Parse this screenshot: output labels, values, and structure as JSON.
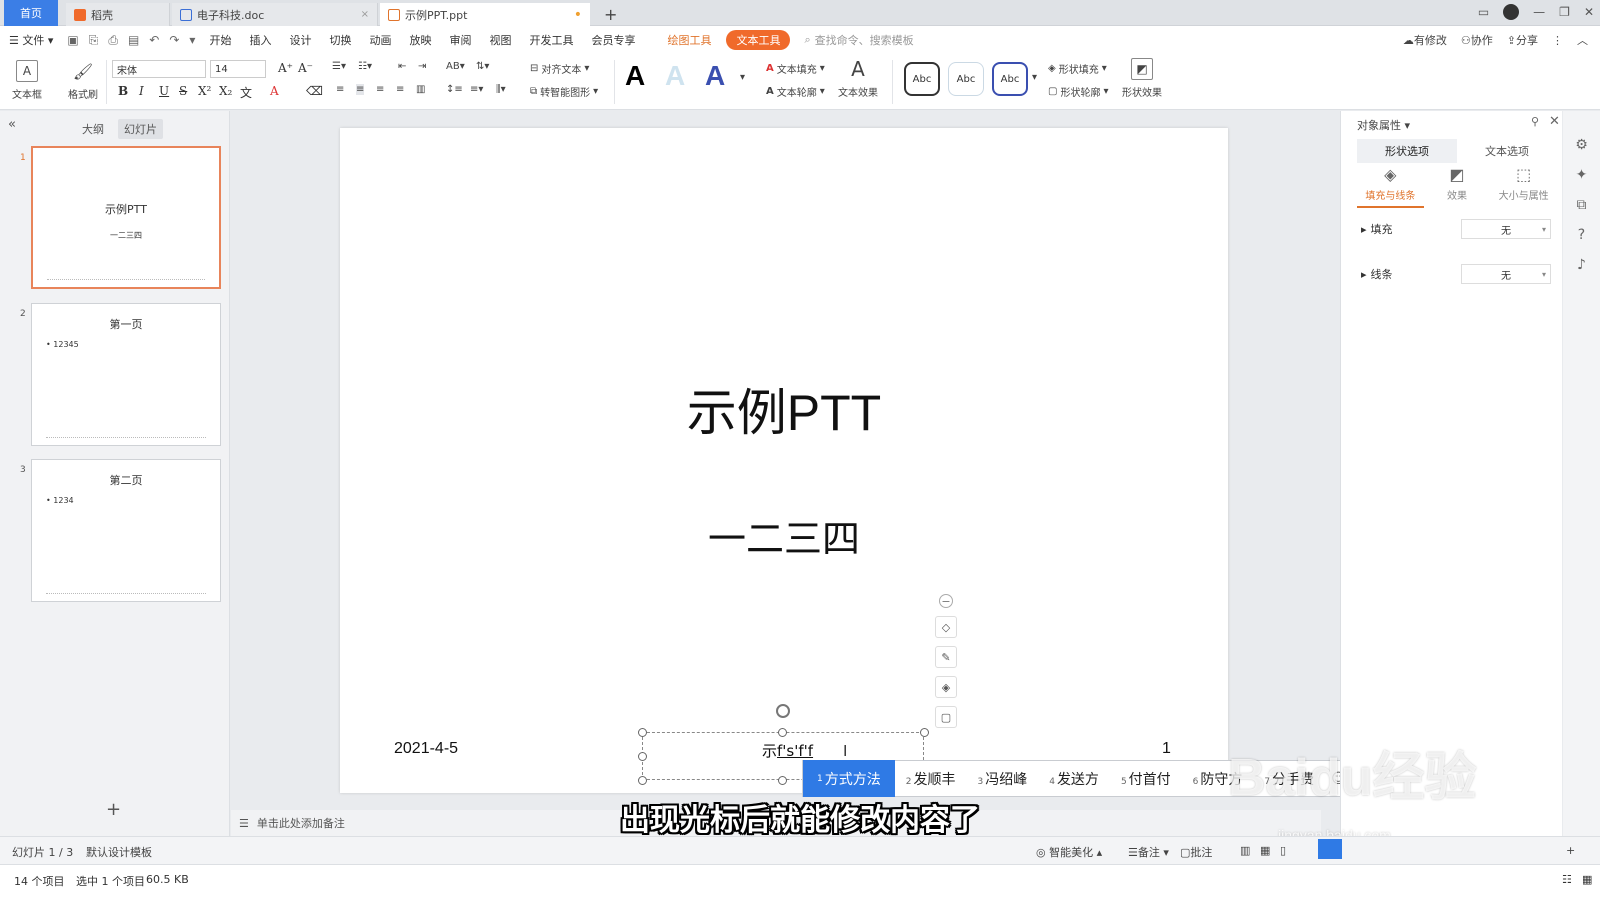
{
  "titlebar": {
    "home_tab": "首页",
    "tabs": [
      {
        "label": "稻壳",
        "icon": "daoke-logo-icon"
      },
      {
        "label": "电子科技.doc",
        "icon": "word-doc-icon"
      },
      {
        "label": "示例PPT.ppt",
        "icon": "ppt-file-icon"
      }
    ],
    "new_tab": "+"
  },
  "menubar": {
    "file": "文件",
    "items": [
      "开始",
      "插入",
      "设计",
      "切换",
      "动画",
      "放映",
      "审阅",
      "视图",
      "开发工具",
      "会员专享"
    ],
    "drawing_tools": "绘图工具",
    "text_tools": "文本工具",
    "search_placeholder": "查找命令、搜索模板",
    "right": [
      "有修改",
      "协作",
      "分享"
    ]
  },
  "ribbon": {
    "textbox": "文本框",
    "format_painter": "格式刷",
    "font_name": "宋体",
    "font_size": "14",
    "align_text": "对齐文本",
    "smart_shape": "转智能图形",
    "text_fill": "文本填充",
    "text_outline": "文本轮廓",
    "text_effect": "文本效果",
    "abc": "Abc",
    "shape_fill": "形状填充",
    "shape_outline": "形状轮廓",
    "shape_effect": "形状效果"
  },
  "left_panel": {
    "tab_outline": "大纲",
    "tab_slides": "幻灯片",
    "slides": [
      {
        "num": "1",
        "title": "示例PTT",
        "subtitle": "一二三四"
      },
      {
        "num": "2",
        "heading": "第一页",
        "bullet": "• 12345"
      },
      {
        "num": "3",
        "heading": "第二页",
        "bullet": "• 1234"
      }
    ],
    "add": "+"
  },
  "slide": {
    "title": "示例PTT",
    "subtitle": "一二三四",
    "date": "2021-4-5",
    "page_num": "1",
    "textbox_prefix": "示",
    "textbox_composing": "f's'f'f"
  },
  "ime": {
    "candidates": [
      {
        "n": "1",
        "text": "方式方法"
      },
      {
        "n": "2",
        "text": "发顺丰"
      },
      {
        "n": "3",
        "text": "冯绍峰"
      },
      {
        "n": "4",
        "text": "发送方"
      },
      {
        "n": "5",
        "text": "付首付"
      },
      {
        "n": "6",
        "text": "防守方"
      },
      {
        "n": "7",
        "text": "分手费"
      }
    ]
  },
  "notes_placeholder": "单击此处添加备注",
  "subtitle_overlay": "出现光标后就能修改内容了",
  "watermark": {
    "brand": "Baidu经验",
    "url": "jingyan.baidu.com"
  },
  "right_panel": {
    "title": "对象属性",
    "tabs": [
      "形状选项",
      "文本选项"
    ],
    "subtabs": [
      "填充与线条",
      "效果",
      "大小与属性"
    ],
    "fill_label": "填充",
    "fill_value": "无",
    "line_label": "线条",
    "line_value": "无"
  },
  "statusbar": {
    "slide_info": "幻灯片 1 / 3",
    "template": "默认设计模板",
    "beautify": "智能美化",
    "notes": "备注",
    "comments": "批注"
  },
  "explorer": {
    "items_count": "14 个项目",
    "selected": "选中 1 个项目",
    "size": "60.5 KB"
  },
  "colors": {
    "accent_blue": "#2f7ae5",
    "accent_orange": "#f06a2b",
    "thumb_select": "#e8845a"
  }
}
